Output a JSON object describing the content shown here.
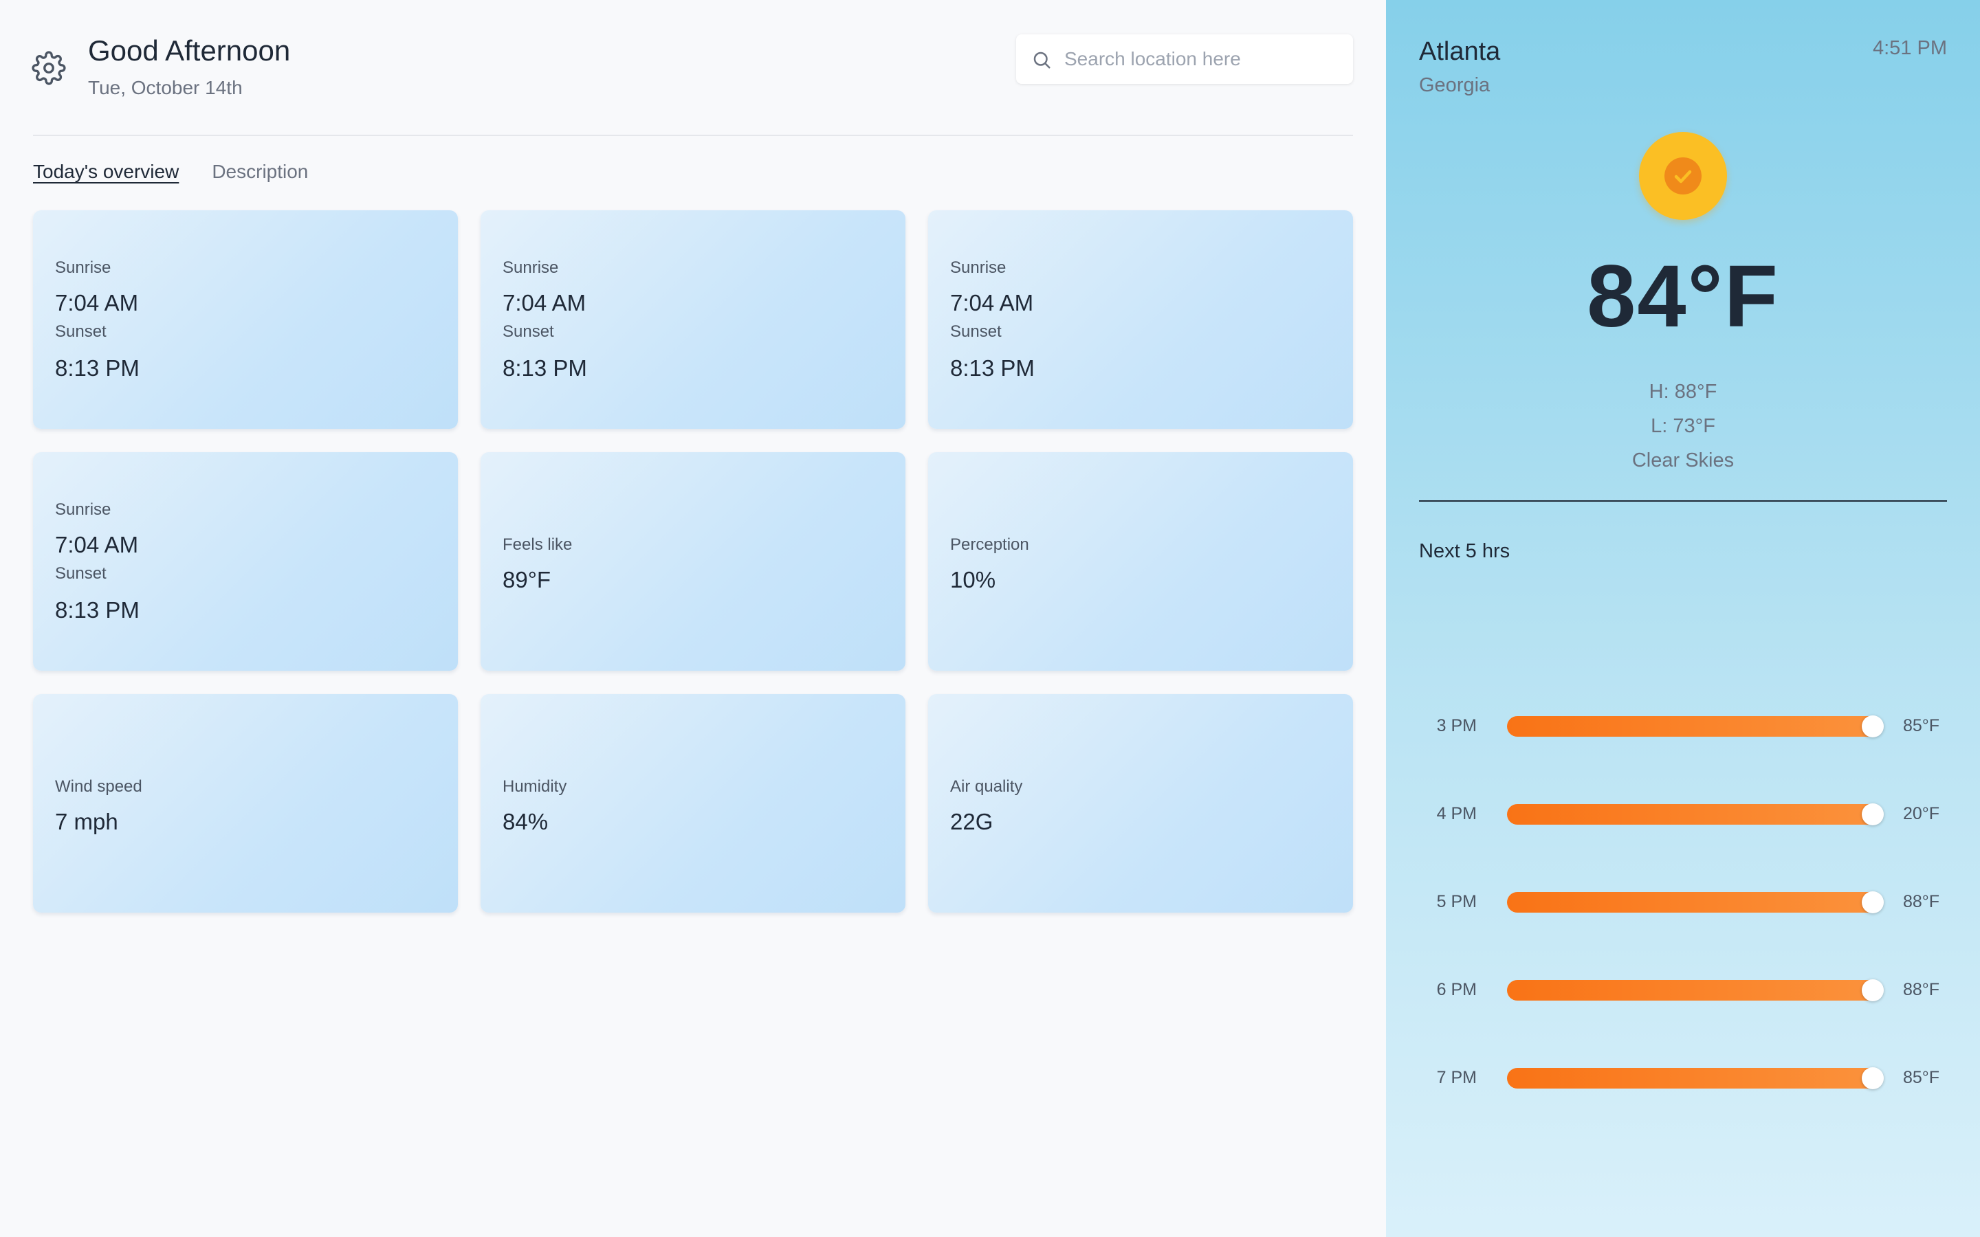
{
  "header": {
    "greeting": "Good Afternoon",
    "date": "Tue, October 14th",
    "settings_icon": "gear-icon"
  },
  "search": {
    "placeholder": "Search location here",
    "value": "",
    "icon": "search-icon"
  },
  "tabs": [
    {
      "label": "Today's overview",
      "active": true
    },
    {
      "label": "Description",
      "active": false
    }
  ],
  "cards": [
    {
      "type": "sun",
      "sunrise_label": "Sunrise",
      "sunrise": "7:04 AM",
      "sunset_label": "Sunset",
      "sunset": "8:13 PM"
    },
    {
      "type": "sun",
      "sunrise_label": "Sunrise",
      "sunrise": "7:04 AM",
      "sunset_label": "Sunset",
      "sunset": "8:13 PM"
    },
    {
      "type": "sun",
      "sunrise_label": "Sunrise",
      "sunrise": "7:04 AM",
      "sunset_label": "Sunset",
      "sunset": "8:13 PM"
    },
    {
      "type": "sun",
      "sunrise_label": "Sunrise",
      "sunrise": "7:04 AM",
      "sunset_label": "Sunset",
      "sunset": "8:13 PM"
    },
    {
      "type": "single",
      "label": "Feels like",
      "value": "89°F"
    },
    {
      "type": "single",
      "label": "Perception",
      "value": "10%"
    },
    {
      "type": "single",
      "label": "Wind speed",
      "value": "7 mph"
    },
    {
      "type": "single",
      "label": "Humidity",
      "value": "84%"
    },
    {
      "type": "single",
      "label": "Air quality",
      "value": "22G"
    }
  ],
  "sidebar": {
    "city": "Atlanta",
    "region": "Georgia",
    "time": "4:51 PM",
    "weather_icon": "sun-check-icon",
    "temperature": "84°F",
    "high": "H: 88°F",
    "low": "L: 73°F",
    "condition": "Clear Skies",
    "forecast_title": "Next 5 hrs",
    "hours": [
      {
        "label": "3 PM",
        "value": "85°F",
        "level": 0.97
      },
      {
        "label": "4 PM",
        "value": "20°F",
        "level": 0.97
      },
      {
        "label": "5 PM",
        "value": "88°F",
        "level": 0.97
      },
      {
        "label": "6 PM",
        "value": "88°F",
        "level": 0.97
      },
      {
        "label": "7 PM",
        "value": "85°F",
        "level": 0.97
      }
    ]
  },
  "colors": {
    "accent_orange": "#f97316",
    "sun_yellow": "#fbbf24",
    "sidebar_top": "#86d0ea",
    "sidebar_bottom": "#d9f0fa",
    "card_tint": "#c9e5fa"
  }
}
